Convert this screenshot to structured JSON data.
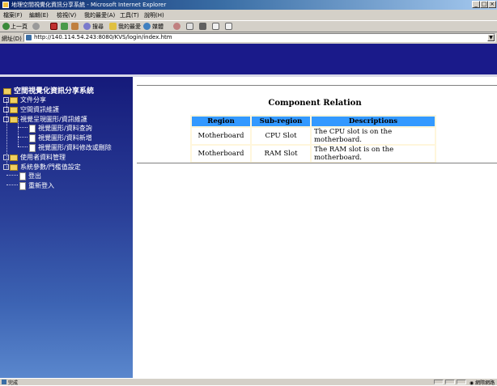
{
  "window": {
    "title": "地理空間視覺化資訊分享系統 - Microsoft Internet Explorer",
    "controls": [
      "_",
      "□",
      "×"
    ]
  },
  "menubar": [
    "檔案(F)",
    "編輯(E)",
    "檢視(V)",
    "我的最愛(A)",
    "工具(T)",
    "說明(H)"
  ],
  "toolbar": {
    "back_label": "上一頁",
    "search_label": "搜尋",
    "favorites_label": "我的最愛",
    "media_label": "媒體"
  },
  "address": {
    "label": "網址(D)",
    "url": "http://140.114.54.243:8080/KVS/login/index.htm"
  },
  "sidebar": {
    "root": "空間視覺化資訊分享系統",
    "items": [
      {
        "label": "文件分享"
      },
      {
        "label": "空間資訊維護"
      },
      {
        "label": "視覺呈現圖形/資訊維護"
      },
      {
        "label": "視覺圖形/資料查詢"
      },
      {
        "label": "視覺圖形/資料新增"
      },
      {
        "label": "視覺圖形/資料修改或刪除"
      },
      {
        "label": "使用者資料管理"
      },
      {
        "label": "系統參數/門檻值設定"
      },
      {
        "label": "登出"
      },
      {
        "label": "重新登入"
      }
    ]
  },
  "content": {
    "title": "Component Relation",
    "columns": [
      "Region",
      "Sub-region",
      "Descriptions"
    ],
    "rows": [
      [
        "Motherboard",
        "CPU Slot",
        "The CPU slot is on the motherboard."
      ],
      [
        "Motherboard",
        "RAM Slot",
        "The RAM slot is on the motherboard."
      ]
    ]
  },
  "status": {
    "text": "完成",
    "zone": "網際網路"
  },
  "colors": {
    "banner": "#1a1a8a",
    "sidebar_top": "#151a7a",
    "sidebar_bottom": "#5a87cd",
    "table_header": "#3399ff",
    "table_bg": "#fff6dc"
  }
}
